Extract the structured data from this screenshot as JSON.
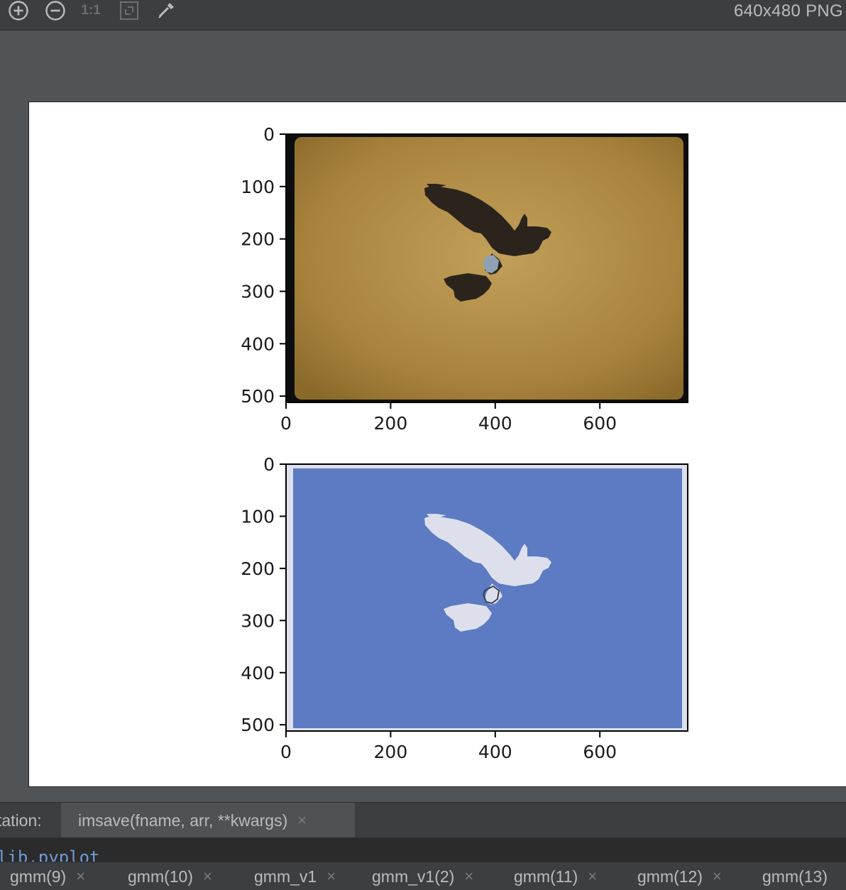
{
  "toolbar": {
    "icons": [
      "zoom-in-icon",
      "zoom-out-icon",
      "actual-size-icon",
      "fit-to-window-icon",
      "color-picker-icon"
    ],
    "actual_size_label": "1:1",
    "image_info": "640x480 PNG"
  },
  "colors": {
    "toolbar_bg": "#3c3f41",
    "viewer_bg": "#505457",
    "photo_bg": "#a57f38",
    "photo_border": "#0d0d0d",
    "bird_dark": "#2a241c",
    "cluster_blue": "#5c7bc2",
    "cluster_light": "#dde0ec"
  },
  "chart_data": [
    {
      "type": "image",
      "content": "photo of a hawk silhouette in flight against a brownish-yellow background",
      "x_ticks": [
        "0",
        "200",
        "400",
        "600"
      ],
      "y_ticks": [
        "0",
        "100",
        "200",
        "300",
        "400",
        "500"
      ],
      "xlim": [
        0,
        768
      ],
      "ylim": [
        512,
        0
      ]
    },
    {
      "type": "image",
      "content": "segmentation result: light hawk silhouette on a blue background",
      "x_ticks": [
        "0",
        "200",
        "400",
        "600"
      ],
      "y_ticks": [
        "0",
        "100",
        "200",
        "300",
        "400",
        "500"
      ],
      "xlim": [
        0,
        768
      ],
      "ylim": [
        512,
        0
      ]
    }
  ],
  "documentation": {
    "label": "tation:",
    "tab_label": "imsave(fname, arr, **kwargs)"
  },
  "code_peek": "lib.pyplot",
  "bottom_tabs": [
    {
      "label": "gmm(9)",
      "closable": true
    },
    {
      "label": "gmm(10)",
      "closable": true
    },
    {
      "label": "gmm_v1",
      "closable": true
    },
    {
      "label": "gmm_v1(2)",
      "closable": true
    },
    {
      "label": "gmm(11)",
      "closable": true
    },
    {
      "label": "gmm(12)",
      "closable": true
    },
    {
      "label": "gmm(13)",
      "closable": false
    }
  ],
  "close_glyph": "×"
}
